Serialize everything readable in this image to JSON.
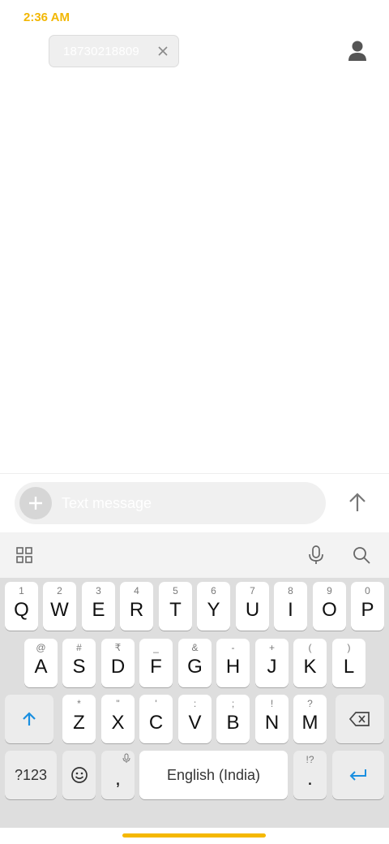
{
  "status_bar": {
    "time": "2:36 AM"
  },
  "recipient": {
    "number": "18730218809"
  },
  "compose": {
    "placeholder": "Text message"
  },
  "keyboard": {
    "row1": [
      {
        "main": "Q",
        "sup": "1"
      },
      {
        "main": "W",
        "sup": "2"
      },
      {
        "main": "E",
        "sup": "3"
      },
      {
        "main": "R",
        "sup": "4"
      },
      {
        "main": "T",
        "sup": "5"
      },
      {
        "main": "Y",
        "sup": "6"
      },
      {
        "main": "U",
        "sup": "7"
      },
      {
        "main": "I",
        "sup": "8"
      },
      {
        "main": "O",
        "sup": "9"
      },
      {
        "main": "P",
        "sup": "0"
      }
    ],
    "row2": [
      {
        "main": "A",
        "sup": "@"
      },
      {
        "main": "S",
        "sup": "#"
      },
      {
        "main": "D",
        "sup": "₹"
      },
      {
        "main": "F",
        "sup": "_"
      },
      {
        "main": "G",
        "sup": "&"
      },
      {
        "main": "H",
        "sup": "-"
      },
      {
        "main": "J",
        "sup": "+"
      },
      {
        "main": "K",
        "sup": "("
      },
      {
        "main": "L",
        "sup": ")"
      }
    ],
    "row3": [
      {
        "main": "Z",
        "sup": "*"
      },
      {
        "main": "X",
        "sup": "\""
      },
      {
        "main": "C",
        "sup": "'"
      },
      {
        "main": "V",
        "sup": ":"
      },
      {
        "main": "B",
        "sup": ";"
      },
      {
        "main": "N",
        "sup": "!"
      },
      {
        "main": "M",
        "sup": "?"
      }
    ],
    "symbols_label": "?123",
    "comma": ",",
    "space_label": "English (India)",
    "period": ".",
    "period_sup": "!?"
  },
  "colors": {
    "accent": "#f2b705",
    "keyboard_blue": "#1a8fe0"
  }
}
